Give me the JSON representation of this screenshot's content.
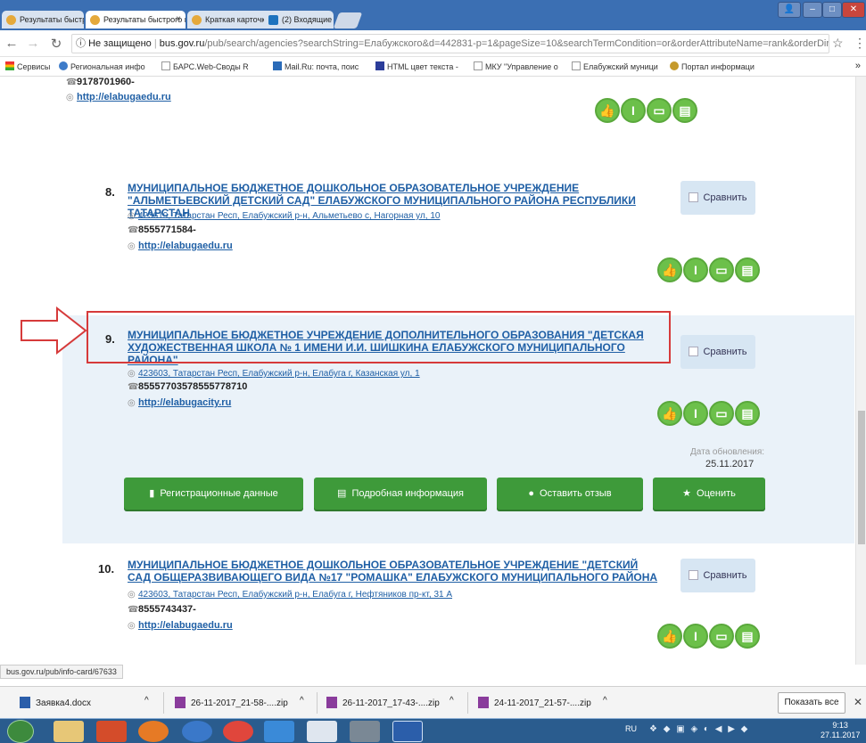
{
  "browser": {
    "tabs": [
      {
        "label": "Результаты быстрого по",
        "active": false
      },
      {
        "label": "Результаты быстрого по",
        "active": true
      },
      {
        "label": "Краткая карточка госуд",
        "active": false
      },
      {
        "label": "(2) Входящие - Почта М",
        "active": false
      }
    ],
    "security_label": "Не защищено",
    "url_domain": "bus.gov.ru",
    "url_path": "/pub/search/agencies?searchString=Елабужского&d=442831-p=1&pageSize=10&searchTermCondition=or&orderAttributeName=rank&orderDire...",
    "bookmarks": [
      "Сервисы",
      "Региональная инфо",
      "БАРС.Web-Своды R",
      "Mail.Ru: почта, поис",
      "HTML цвет текста - ",
      "МКУ \"Управление о",
      "Елабужский муници",
      "Портал информаци"
    ]
  },
  "results": {
    "prev": {
      "phone": "9178701960-",
      "site": "http://elabugaedu.ru"
    },
    "item8": {
      "number": "8.",
      "title": "МУНИЦИПАЛЬНОЕ БЮДЖЕТНОЕ ДОШКОЛЬНОЕ ОБРАЗОВАТЕЛЬНОЕ УЧРЕЖДЕНИЕ \"АЛЬМЕТЬЕВСКИЙ ДЕТСКИЙ САД\" ЕЛАБУЖСКОГО МУНИЦИПАЛЬНОГО РАЙОНА РЕСПУБЛИКИ ТАТАРСТАН",
      "address": "423619, Татарстан Респ, Елабужский р-н, Альметьево с, Нагорная ул, 10",
      "phone": "8555771584-",
      "site": "http://elabugaedu.ru",
      "compare": "Сравнить"
    },
    "item9": {
      "number": "9.",
      "title": "МУНИЦИПАЛЬНОЕ БЮДЖЕТНОЕ УЧРЕЖДЕНИЕ ДОПОЛНИТЕЛЬНОГО ОБРАЗОВАНИЯ \"ДЕТСКАЯ ХУДОЖЕСТВЕННАЯ ШКОЛА № 1 ИМЕНИ И.И. ШИШКИНА ЕЛАБУЖСКОГО МУНИЦИПАЛЬНОГО РАЙОНА\"",
      "address": "423603, Татарстан Респ, Елабужский р-н, Елабуга г, Казанская ул, 1",
      "phone": "85557703578555778710",
      "site": "http://elabugacity.ru",
      "compare": "Сравнить",
      "update_label": "Дата обновления:",
      "update_date": "25.11.2017",
      "buttons": {
        "reg": "Регистрационные данные",
        "info": "Подробная информация",
        "review": "Оставить отзыв",
        "rate": "Оценить"
      }
    },
    "item10": {
      "number": "10.",
      "title": "МУНИЦИПАЛЬНОЕ БЮДЖЕТНОЕ ДОШКОЛЬНОЕ ОБРАЗОВАТЕЛЬНОЕ УЧРЕЖДЕНИЕ \"ДЕТСКИЙ САД ОБЩЕРАЗВИВАЮЩЕГО ВИДА №17 \"РОМАШКА\" ЕЛАБУЖСКОГО МУНИЦИПАЛЬНОГО РАЙОНА",
      "address": "423603, Татарстан Респ, Елабужский р-н, Елабуга г, Нефтяников пр-кт, 31 А",
      "phone": "8555743437-",
      "site": "http://elabugaedu.ru",
      "compare": "Сравнить"
    }
  },
  "status_url": "bus.gov.ru/pub/info-card/67633",
  "downloads": {
    "files": [
      "Заявка4.docx",
      "26-11-2017_21-58-....zip",
      "26-11-2017_17-43-....zip",
      "24-11-2017_21-57-....zip"
    ],
    "show_all": "Показать все"
  },
  "taskbar": {
    "lang": "RU",
    "time": "9:13",
    "date": "27.11.2017"
  },
  "colors": {
    "link": "#1f5fa5",
    "green": "#3e9a3a",
    "highlight": "#d63a3a",
    "active_bg": "#eaf2f9"
  }
}
